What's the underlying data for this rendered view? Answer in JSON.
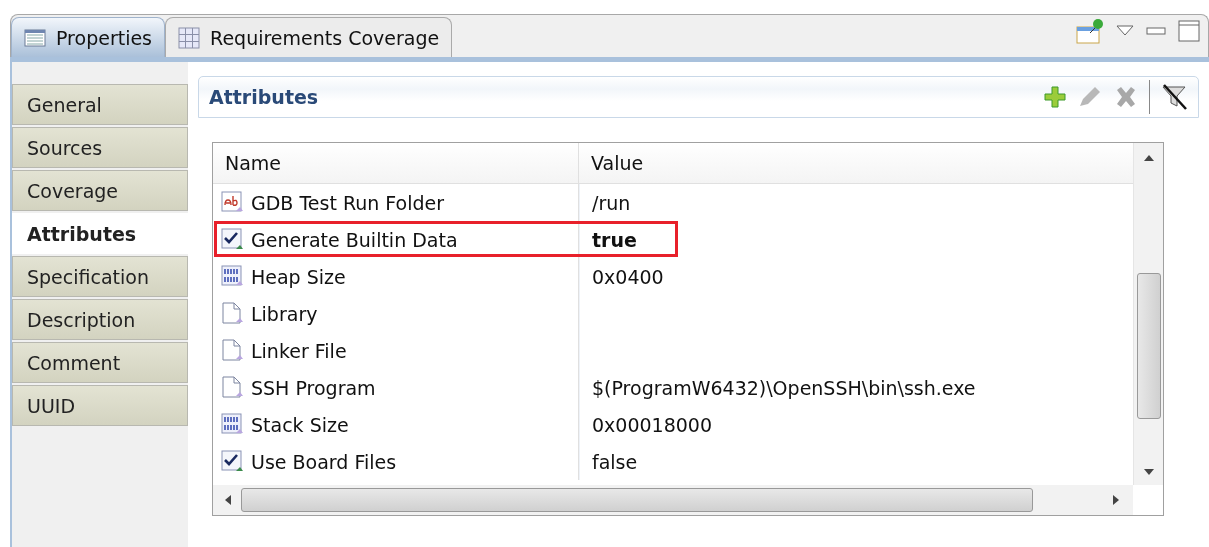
{
  "view_tabs": [
    {
      "label": "Properties",
      "selected": true
    },
    {
      "label": "Requirements Coverage",
      "selected": false
    }
  ],
  "side_tabs": [
    {
      "label": "General",
      "selected": false
    },
    {
      "label": "Sources",
      "selected": false
    },
    {
      "label": "Coverage",
      "selected": false
    },
    {
      "label": "Attributes",
      "selected": true
    },
    {
      "label": "Specification",
      "selected": false
    },
    {
      "label": "Description",
      "selected": false
    },
    {
      "label": "Comment",
      "selected": false
    },
    {
      "label": "UUID",
      "selected": false
    }
  ],
  "section": {
    "title": "Attributes",
    "tools": [
      {
        "kind": "add",
        "disabled": false
      },
      {
        "kind": "edit",
        "disabled": true
      },
      {
        "kind": "delete",
        "disabled": true
      },
      {
        "kind": "filter",
        "disabled": false
      }
    ]
  },
  "table": {
    "columns": [
      "Name",
      "Value"
    ],
    "rows": [
      {
        "kind": "text",
        "name": "GDB Test Run Folder",
        "value": "/run",
        "modified": false,
        "highlighted": false
      },
      {
        "kind": "checkbox",
        "name": "Generate Builtin Data",
        "value": "true",
        "modified": true,
        "highlighted": true
      },
      {
        "kind": "number",
        "name": "Heap Size",
        "value": "0x0400",
        "modified": false,
        "highlighted": false
      },
      {
        "kind": "file",
        "name": "Library",
        "highlighted": false
      },
      {
        "kind": "file",
        "name": "Linker File",
        "highlighted": false
      },
      {
        "kind": "file",
        "name": "SSH Program",
        "value": "$(ProgramW6432)\\OpenSSH\\bin\\ssh.exe",
        "modified": false,
        "highlighted": false
      },
      {
        "kind": "number",
        "name": "Stack Size",
        "value": "0x00018000",
        "modified": false,
        "highlighted": false
      },
      {
        "kind": "checkbox",
        "name": "Use Board Files",
        "value": "false",
        "modified": false,
        "highlighted": false
      }
    ]
  }
}
